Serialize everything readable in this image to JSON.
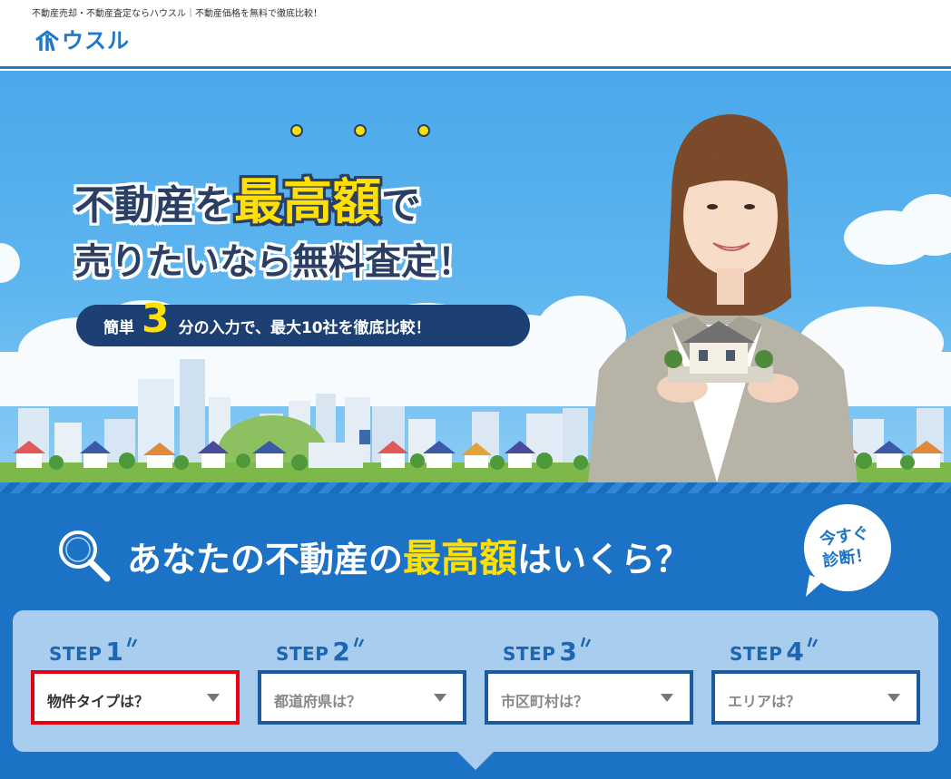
{
  "header": {
    "tagline": "不動産売却・不動産査定ならハウスル｜不動産価格を無料で徹底比較！",
    "logo_text": "ウスル"
  },
  "hero": {
    "headline_pre": "不動産を",
    "headline_highlight": "最高額",
    "headline_post": "で",
    "headline_line2": "売りたいなら無料査定！",
    "pill_pre": "簡単",
    "pill_number": "3",
    "pill_post": "分の入力で、最大10社を徹底比較！"
  },
  "form": {
    "question_pre": "あなたの不動産の",
    "question_highlight": "最高額",
    "question_post": "はいくら？",
    "badge_line1": "今すぐ",
    "badge_line2": "診断！",
    "steps": [
      {
        "label": "STEP",
        "number": "1",
        "placeholder": "物件タイプは？"
      },
      {
        "label": "STEP",
        "number": "2",
        "placeholder": "都道府県は？"
      },
      {
        "label": "STEP",
        "number": "3",
        "placeholder": "市区町村は？"
      },
      {
        "label": "STEP",
        "number": "4",
        "placeholder": "エリアは？"
      }
    ]
  },
  "colors": {
    "brand_blue": "#1c72c5",
    "highlight_yellow": "#ffe000",
    "active_border": "#e60012"
  }
}
